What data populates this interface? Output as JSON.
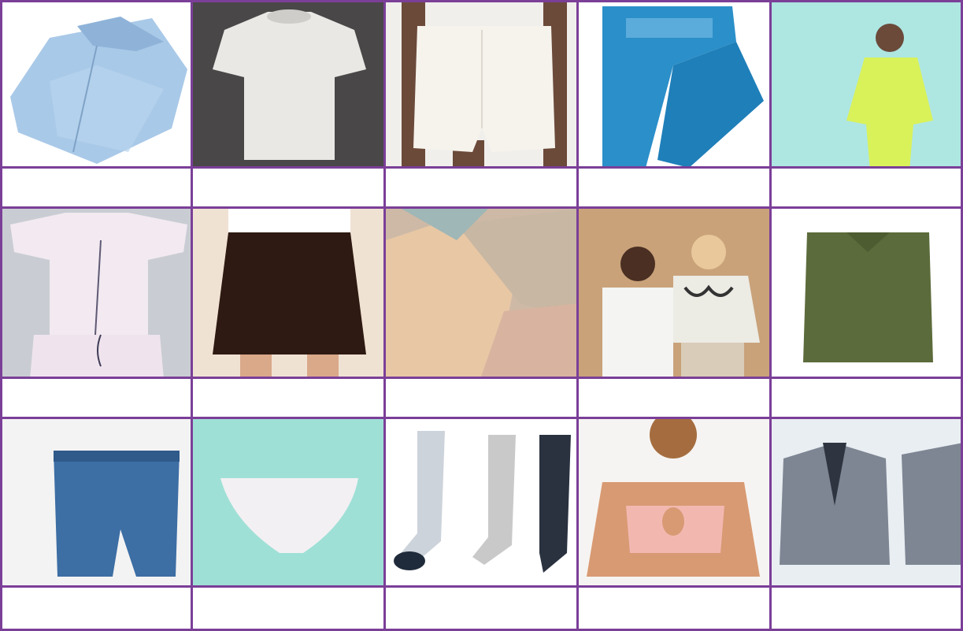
{
  "grid": {
    "rows": 3,
    "columns": 5,
    "border_color": "#7b3f98",
    "items": [
      {
        "name": "shirt",
        "label": ""
      },
      {
        "name": "t-shirt",
        "label": ""
      },
      {
        "name": "shorts",
        "label": ""
      },
      {
        "name": "jeans",
        "label": ""
      },
      {
        "name": "hoodie",
        "label": ""
      },
      {
        "name": "pajamas",
        "label": ""
      },
      {
        "name": "skirt",
        "label": ""
      },
      {
        "name": "dress",
        "label": ""
      },
      {
        "name": "sweatshirt",
        "label": ""
      },
      {
        "name": "sweater",
        "label": ""
      },
      {
        "name": "boxer-briefs",
        "label": ""
      },
      {
        "name": "panties",
        "label": ""
      },
      {
        "name": "socks",
        "label": ""
      },
      {
        "name": "sports-bra",
        "label": ""
      },
      {
        "name": "blazer",
        "label": ""
      }
    ]
  }
}
